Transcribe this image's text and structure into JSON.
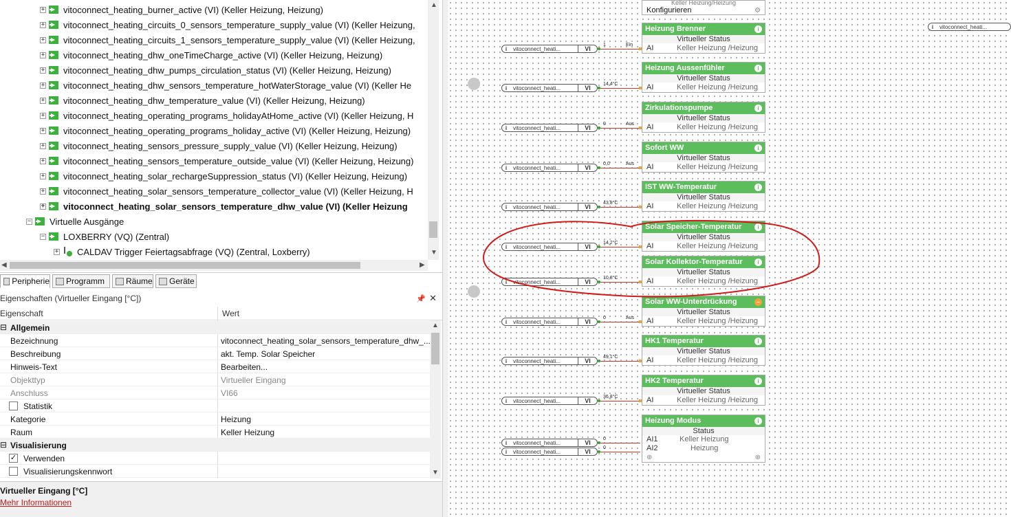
{
  "tree": {
    "rows": [
      {
        "label": "vitoconnect_heating_burner_active (VI) (Keller Heizung, Heizung)",
        "bold": false
      },
      {
        "label": "vitoconnect_heating_circuits_0_sensors_temperature_supply_value (VI) (Keller Heizung,",
        "bold": false
      },
      {
        "label": "vitoconnect_heating_circuits_1_sensors_temperature_supply_value (VI) (Keller Heizung,",
        "bold": false
      },
      {
        "label": "vitoconnect_heating_dhw_oneTimeCharge_active (VI) (Keller Heizung, Heizung)",
        "bold": false
      },
      {
        "label": "vitoconnect_heating_dhw_pumps_circulation_status (VI) (Keller Heizung, Heizung)",
        "bold": false
      },
      {
        "label": "vitoconnect_heating_dhw_sensors_temperature_hotWaterStorage_value (VI) (Keller He",
        "bold": false
      },
      {
        "label": "vitoconnect_heating_dhw_temperature_value (VI) (Keller Heizung, Heizung)",
        "bold": false
      },
      {
        "label": "vitoconnect_heating_operating_programs_holidayAtHome_active (VI) (Keller Heizung, H",
        "bold": false
      },
      {
        "label": "vitoconnect_heating_operating_programs_holiday_active (VI) (Keller Heizung, Heizung)",
        "bold": false
      },
      {
        "label": "vitoconnect_heating_sensors_pressure_supply_value (VI) (Keller Heizung, Heizung)",
        "bold": false
      },
      {
        "label": "vitoconnect_heating_sensors_temperature_outside_value (VI) (Keller Heizung, Heizung)",
        "bold": false
      },
      {
        "label": "vitoconnect_heating_solar_rechargeSuppression_status (VI) (Keller Heizung, Heizung)",
        "bold": false
      },
      {
        "label": "vitoconnect_heating_solar_sensors_temperature_collector_value (VI) (Keller Heizung, H",
        "bold": false
      },
      {
        "label": "vitoconnect_heating_solar_sensors_temperature_dhw_value (VI) (Keller Heizung",
        "bold": true
      }
    ],
    "virtual_outputs": "Virtuelle Ausgänge",
    "loxberry": "LOXBERRY (VQ) (Zentral)",
    "caldav": "CALDAV Trigger Feiertagsabfrage (VQ) (Zentral, Loxberry)"
  },
  "tabs": [
    "Peripherie",
    "Programm",
    "Räume",
    "Geräte"
  ],
  "props": {
    "title": "Eigenschaften (Virtueller Eingang [°C])",
    "col_prop": "Eigenschaft",
    "col_val": "Wert",
    "sec_general": "Allgemein",
    "rows": [
      {
        "k": "Bezeichnung",
        "v": "vitoconnect_heating_solar_sensors_temperature_dhw_..."
      },
      {
        "k": "Beschreibung",
        "v": "akt. Temp. Solar Speicher"
      },
      {
        "k": "Hinweis-Text",
        "v": "Bearbeiten..."
      },
      {
        "k": "Objekttyp",
        "v": "Virtueller Eingang"
      },
      {
        "k": "Anschluss",
        "v": "VI66"
      },
      {
        "k": "Statistik",
        "v": ""
      },
      {
        "k": "Kategorie",
        "v": "Heizung"
      },
      {
        "k": "Raum",
        "v": "Keller Heizung"
      }
    ],
    "sec_vis": "Visualisierung",
    "use": "Verwenden",
    "vis_pw": "Visualisierungskennwort"
  },
  "desc": {
    "title": "Virtueller Eingang [°C]",
    "link": "Mehr Informationen"
  },
  "canvas": {
    "top_block": {
      "sub": "Keller Heizung/Heizung",
      "cfg": "Konfigurieren"
    },
    "floating_input": "vitoconnect_heati...",
    "input_name": "vitoconnect_heati...",
    "vi": "VI",
    "status": "Virtueller Status",
    "ai": "AI",
    "room": "Keller Heizung /Heizung",
    "blocks": [
      {
        "title": "Heizung Brenner",
        "val": "1",
        "out": "Ein"
      },
      {
        "title": "Heizung Aussenfühler",
        "val": "14,4°C",
        "out": ""
      },
      {
        "title": "Zirkulationspumpe",
        "val": "0",
        "out": "Aus"
      },
      {
        "title": "Sofort WW",
        "val": "0,0",
        "out": "Aus"
      },
      {
        "title": "IST WW-Temperatur",
        "val": "43,8°C",
        "out": ""
      },
      {
        "title": "Solar Speicher-Temperatur",
        "val": "14,2°C",
        "out": ""
      },
      {
        "title": "Solar Kollektor-Temperatur",
        "val": "10,8°C",
        "out": ""
      },
      {
        "title": "Solar WW-Unterdrückung",
        "val": "0",
        "out": "Aus"
      },
      {
        "title": "HK1 Temperatur",
        "val": "49,1°C",
        "out": ""
      },
      {
        "title": "HK2 Temperatur",
        "val": "36,8°C",
        "out": ""
      }
    ],
    "modus": {
      "title": "Heizung Modus",
      "status": "Status",
      "ai1": "AI1",
      "ai2": "AI2",
      "r1": "Keller Heizung",
      "r2": "Heizung",
      "v1": "0",
      "v2": "0"
    }
  }
}
